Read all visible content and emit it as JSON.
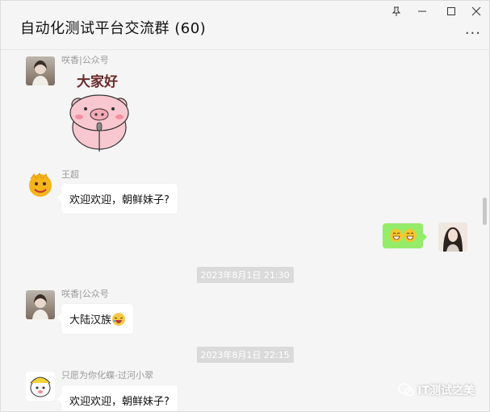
{
  "window": {
    "title": "自动化测试平台交流群 (60)",
    "controls": {
      "pin": "⊥",
      "minimize": "—",
      "maximize": "□",
      "close": "✕"
    },
    "more": "···"
  },
  "messages": [
    {
      "sender": "咲香|公众号",
      "type": "sticker",
      "sticker_text": "大家好"
    },
    {
      "sender": "王超",
      "text": "欢迎欢迎，朝鲜妹子?"
    },
    {
      "sender": "",
      "mine": true,
      "emoji": [
        "grin-emoji",
        "grin-emoji"
      ]
    },
    {
      "timestamp": "2023年8月1日 21:30"
    },
    {
      "sender": "咲香|公众号",
      "text": "大陆汉族"
    },
    {
      "timestamp": "2023年8月1日 22:15"
    },
    {
      "sender": "只愿为你化蝶-过河小翠",
      "text": "欢迎欢迎，朝鲜妹子?"
    }
  ],
  "watermark": "IT测试之美",
  "colors": {
    "my_bubble": "#95ec69",
    "background": "#f5f5f5",
    "timestamp_bg": "#dadada"
  }
}
